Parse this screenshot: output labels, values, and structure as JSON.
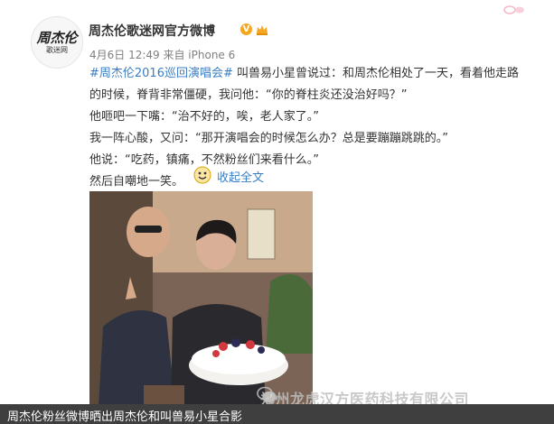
{
  "post": {
    "avatar": {
      "logo_main": "周杰伦",
      "logo_sub": "歌迷网"
    },
    "username": "周杰伦歌迷网官方微博",
    "verified_mark": "V",
    "meta": "4月6日 12:49 来自 iPhone 6",
    "hashtag": "#周杰伦2016巡回演唱会#",
    "lines": [
      " 叫兽易小星曾说过：和周杰伦相处了一天，看着他走路",
      "的时候，脊背非常僵硬，我问他：“你的脊柱炎还没治好吗？”",
      "他咂吧一下嘴：“治不好的，唉，老人家了。”",
      "我一阵心酸，又问：“那开演唱会的时候怎么办？总是要蹦蹦跳跳的。”",
      "他说：“吃药，镇痛，不然粉丝们来看什么。”",
      "然后自嘲地一笑。"
    ],
    "collapse_label": "收起全文"
  },
  "watermark": "郑州龙虎汉方医药科技有限公司",
  "caption": "周杰伦粉丝微博晒出周杰伦和叫兽易小星合影",
  "colors": {
    "link": "#3b7dc2",
    "text": "#333333",
    "meta": "#808080",
    "verified": "#f5a623",
    "caption_bg": "#3f3f3f"
  },
  "icons": {
    "verified": "verified-v-icon",
    "member": "crown-member-icon",
    "collapse": "collapse-emoji-icon",
    "watermark": "wechat-icon"
  }
}
